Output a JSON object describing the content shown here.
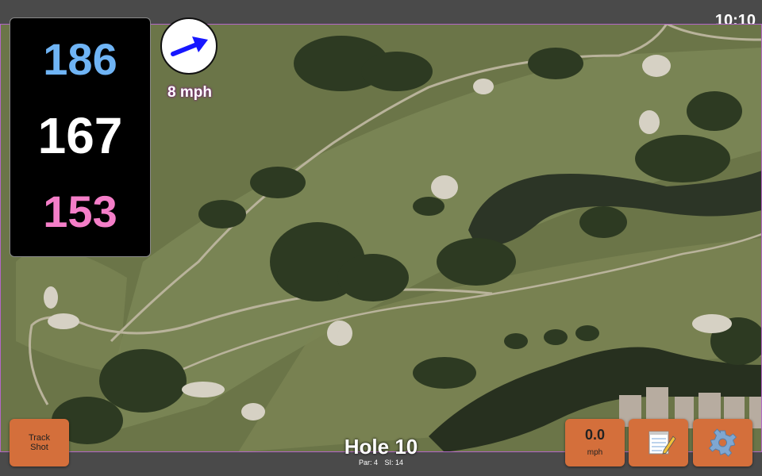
{
  "status_bar": {
    "time": "10:10"
  },
  "distances": {
    "back": "186",
    "center": "167",
    "front": "153"
  },
  "wind": {
    "speed": "8 mph",
    "icon": "wind-arrow-icon",
    "arrow_color": "#1717ff"
  },
  "buttons": {
    "track_shot_line1": "Track",
    "track_shot_line2": "Shot",
    "speed_value": "0.0",
    "speed_unit": "mph",
    "notes_icon": "notepad-icon",
    "settings_icon": "gear-icon"
  },
  "hole": {
    "title": "Hole 10",
    "par": "Par: 4",
    "si": "SI: 14"
  },
  "colors": {
    "back_distance": "#6fb4f5",
    "center_distance": "#ffffff",
    "front_distance": "#f47ec8",
    "button_orange": "#d46f3b",
    "map_border": "#b366c7"
  }
}
